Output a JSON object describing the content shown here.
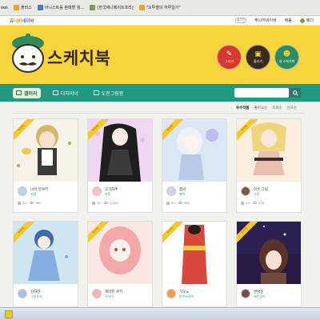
{
  "bookmarks": [
    {
      "label": "ook",
      "icon": "bookmark-icon"
    },
    {
      "label": "플러스",
      "icon": "star-icon"
    },
    {
      "label": "아니스트를 판매할 월…",
      "icon": "ebay-icon"
    },
    {
      "label": "[한국애니메이트프리]",
      "icon": "green-icon"
    },
    {
      "label": "\"오투벨의 하루일기\"",
      "icon": "page-icon"
    }
  ],
  "site_top": {
    "logo_parts": [
      "쥬",
      "니버",
      "네이",
      "버"
    ],
    "search_mini": "로그인",
    "links": [
      "주니어네이버",
      "배움",
      "웨더"
    ]
  },
  "header": {
    "title": "스케치북",
    "buttons": [
      {
        "label": "그리기",
        "icon": "brush-icon"
      },
      {
        "label": "올리기",
        "icon": "upload-icon"
      },
      {
        "label": "내 스케치북",
        "icon": "book-icon"
      }
    ]
  },
  "nav": {
    "tabs": [
      {
        "label": "갤러리",
        "icon": "gallery-icon"
      },
      {
        "label": "디자이너",
        "icon": "designer-icon"
      },
      {
        "label": "도전그림왕",
        "icon": "crown-icon"
      }
    ],
    "search_placeholder": "",
    "search_icon": "search-icon"
  },
  "sort": {
    "options": [
      "우수작품",
      "좋아요순",
      "조회순",
      "신규순"
    ],
    "selected": 0
  },
  "cards": [
    {
      "badge": "우수작",
      "title": "녀석 앙쿠키",
      "author": "만점",
      "likes": "24",
      "views": "781",
      "avatar_color": "#b5d7e8"
    },
    {
      "badge": "우수작",
      "title": "공기처추",
      "author": "카투",
      "likes": "20",
      "views": "1,209",
      "avatar_color": "#efc5c5"
    },
    {
      "badge": "우수작",
      "title": "좀비",
      "author": "별이",
      "likes": "20",
      "views": "382",
      "avatar_color": "#c9d6ee"
    },
    {
      "badge": "우수작",
      "title": "이웃 그림",
      "author": "그린",
      "likes": "13",
      "views": "270",
      "avatar_color": "#7b5a48"
    },
    {
      "badge": "우수작",
      "title": "김하진",
      "author": "그림투지",
      "likes": "",
      "views": "",
      "avatar_color": "#a8c0e6"
    },
    {
      "badge": "우수작",
      "title": "해라진 쿠키",
      "author": "나이나",
      "likes": "",
      "views": "",
      "avatar_color": "#efb5b5"
    },
    {
      "badge": "우수작",
      "title": "기모노",
      "author": "반주요정이",
      "likes": "",
      "views": "",
      "avatar_color": "#e8a04a"
    },
    {
      "badge": "우수작",
      "title": "변명중",
      "author": "혜진공이",
      "likes": "",
      "views": "",
      "avatar_color": "#6e5050"
    }
  ]
}
